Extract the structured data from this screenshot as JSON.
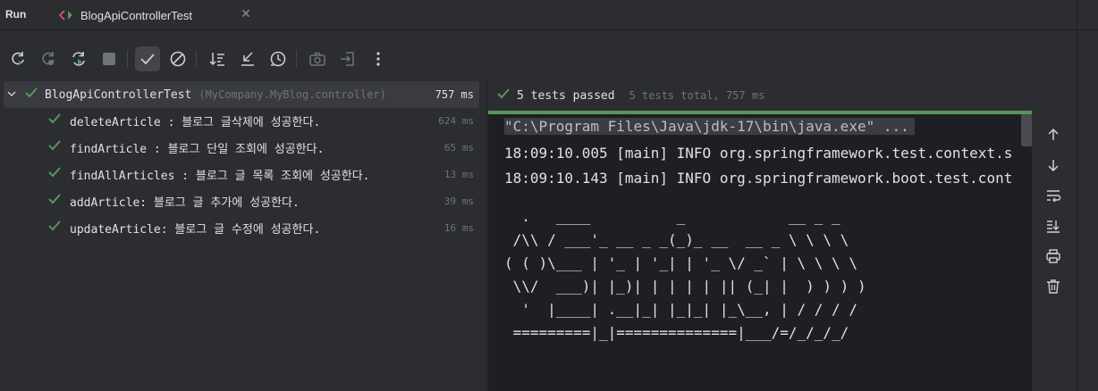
{
  "panel_title": "Run",
  "tab": {
    "label": "BlogApiControllerTest"
  },
  "toolbar": {
    "buttons": [
      {
        "name": "rerun-icon",
        "icon": "rerun"
      },
      {
        "name": "rerun-failed-icon",
        "icon": "rerun-failed"
      },
      {
        "name": "rerun-auto-icon",
        "icon": "toggle-auto-test"
      },
      {
        "name": "stop-icon",
        "icon": "stop"
      },
      {
        "name": "show-passed-icon",
        "icon": "check",
        "active": true
      },
      {
        "name": "show-ignored-icon",
        "icon": "no-entry"
      },
      {
        "name": "sort-alpha-icon",
        "icon": "sort"
      },
      {
        "name": "collapse-icon",
        "icon": "collapse"
      },
      {
        "name": "history-icon",
        "icon": "clock"
      },
      {
        "name": "camera-icon",
        "icon": "camera"
      },
      {
        "name": "import-icon",
        "icon": "import"
      },
      {
        "name": "more-icon",
        "icon": "more-vertical"
      }
    ]
  },
  "tree": {
    "root": {
      "name": "BlogApiControllerTest",
      "package": "(MyCompany.MyBlog.controller)",
      "time": "757 ms"
    },
    "items": [
      {
        "name": "deleteArticle : 블로그 글삭제에 성공한다.",
        "time": "624 ms"
      },
      {
        "name": "findArticle : 블로그 단일 조회에 성공한다.",
        "time": "65 ms"
      },
      {
        "name": "findAllArticles : 블로그 글 목록 조회에 성공한다.",
        "time": "13 ms"
      },
      {
        "name": "addArticle: 블로그 글 추가에 성공한다.",
        "time": "39 ms"
      },
      {
        "name": "updateArticle: 블로그 글 수정에 성공한다.",
        "time": "16 ms"
      }
    ]
  },
  "results": {
    "passed": "5 tests passed",
    "total": "5 tests total, 757 ms",
    "progress": 1.0
  },
  "console": {
    "cmd": "\"C:\\Program Files\\Java\\jdk-17\\bin\\java.exe\" ...",
    "log1": "18:09:10.005 [main] INFO org.springframework.test.context.s",
    "log2": "18:09:10.143 [main] INFO org.springframework.boot.test.cont",
    "banner": "  .   ____          _            __ _ _\n /\\\\ / ___'_ __ _ _(_)_ __  __ _ \\ \\ \\ \\\n( ( )\\___ | '_ | '_| | '_ \\/ _` | \\ \\ \\ \\\n \\\\/  ___)| |_)| | | | | || (_| |  ) ) ) )\n  '  |____| .__|_| |_|_| |_\\__, | / / / /\n =========|_|==============|___/=/_/_/_/"
  },
  "colors": {
    "pass": "#57965c",
    "background": "#2b2d30",
    "console": "#1e1f22"
  }
}
